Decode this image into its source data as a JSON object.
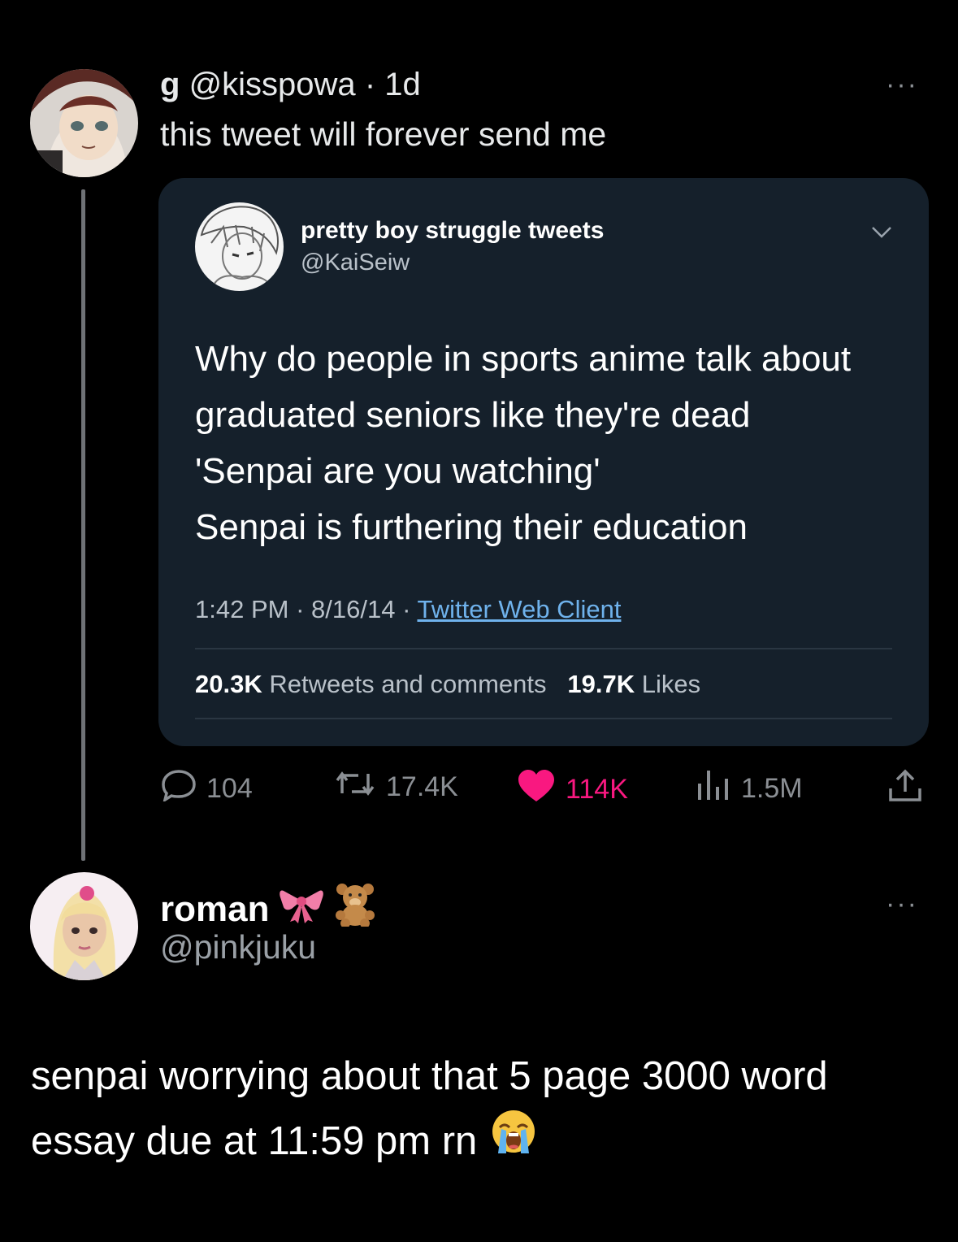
{
  "quote_tweet": {
    "display_name": "g",
    "handle": "@kisspowa",
    "separator": "·",
    "time": "1d",
    "text": "this tweet will forever send me",
    "more": "···"
  },
  "embedded_tweet": {
    "display_name": "pretty boy struggle tweets",
    "handle": "@KaiSeiw",
    "body_lines": [
      "Why do people in sports anime talk about",
      "graduated seniors like they're dead",
      "'Senpai are you watching'",
      "Senpai is furthering their education"
    ],
    "time": "1:42 PM",
    "date": "8/16/14",
    "separator": "·",
    "client": "Twitter Web Client",
    "retweets_count": "20.3K",
    "retweets_label": "Retweets and comments",
    "likes_count": "19.7K",
    "likes_label": "Likes"
  },
  "actions": {
    "replies": "104",
    "retweets": "17.4K",
    "likes": "114K",
    "views": "1.5M",
    "like_color": "#f91880"
  },
  "reply_tweet": {
    "display_name": "roman",
    "name_emojis": [
      "ribbon",
      "teddy-bear"
    ],
    "handle": "@pinkjuku",
    "body_lines": [
      "senpai worrying about that 5 page 3000 word",
      "essay due at 11:59 pm rn"
    ],
    "body_emoji": "loudly-crying-face",
    "more": "···"
  }
}
